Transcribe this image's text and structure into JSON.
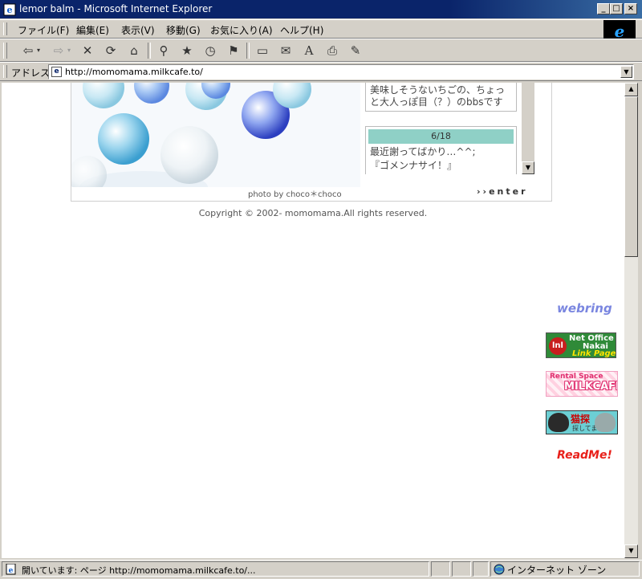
{
  "window": {
    "title": "lemor   balm - Microsoft Internet Explorer",
    "controls": {
      "minimize": "_",
      "maximize": "□",
      "close": "×"
    }
  },
  "menu": {
    "items": [
      "ファイル(F)",
      "編集(E)",
      "表示(V)",
      "移動(G)",
      "お気に入り(A)",
      "ヘルプ(H)"
    ],
    "brand_logo": "e"
  },
  "toolbar": {
    "buttons": [
      {
        "icon": "back-icon",
        "glyph": "⇦"
      },
      {
        "icon": "forward-icon",
        "glyph": "⇨"
      },
      {
        "icon": "stop-icon",
        "glyph": "✕"
      },
      {
        "icon": "refresh-icon",
        "glyph": "⟳"
      },
      {
        "icon": "home-icon",
        "glyph": "⌂"
      },
      {
        "icon": "search-icon",
        "glyph": "⚲"
      },
      {
        "icon": "favorites-icon",
        "glyph": "★"
      },
      {
        "icon": "history-icon",
        "glyph": "◷"
      },
      {
        "icon": "channels-icon",
        "glyph": "⚑"
      },
      {
        "icon": "fullscreen-icon",
        "glyph": "▭"
      },
      {
        "icon": "mail-icon",
        "glyph": "✉"
      },
      {
        "icon": "font-size-icon",
        "glyph": "A"
      },
      {
        "icon": "print-icon",
        "glyph": "⎙"
      },
      {
        "icon": "edit-icon",
        "glyph": "✎"
      }
    ]
  },
  "address": {
    "label": "アドレス",
    "url": "http://momomama.milkcafe.to/"
  },
  "page": {
    "news1": "美味しそうないちごの、ちょっと大人っぽ目（？）のbbsです",
    "news2_date": "6/18",
    "news2_line1": "最近謝ってばかり…^^;",
    "news2_line2": "『ゴメンナサイ！』",
    "photo_credit": "photo by choco＊choco",
    "enter": "››enter",
    "copyright": "Copyright © 2002- momomama.All rights reserved."
  },
  "banners": {
    "webring": "webring",
    "netoffice_l1": "Net Office",
    "netoffice_l2": "Nakai",
    "netoffice_l3": "Link Page",
    "netoffice_badge": "lnl",
    "milk_a": "Rental Space",
    "milk_b": "MILKCAFE",
    "neko_t1": "猫探",
    "neko_t2": "探してます",
    "readme": "ReadMe!"
  },
  "status": {
    "text": "開いています: ページ http://momomama.milkcafe.to/...",
    "zone": "インターネット ゾーン"
  },
  "colors": {
    "titlebar": "#0a246a",
    "news_date_bg": "#8fd0c6",
    "chrome": "#d4d0c8"
  }
}
